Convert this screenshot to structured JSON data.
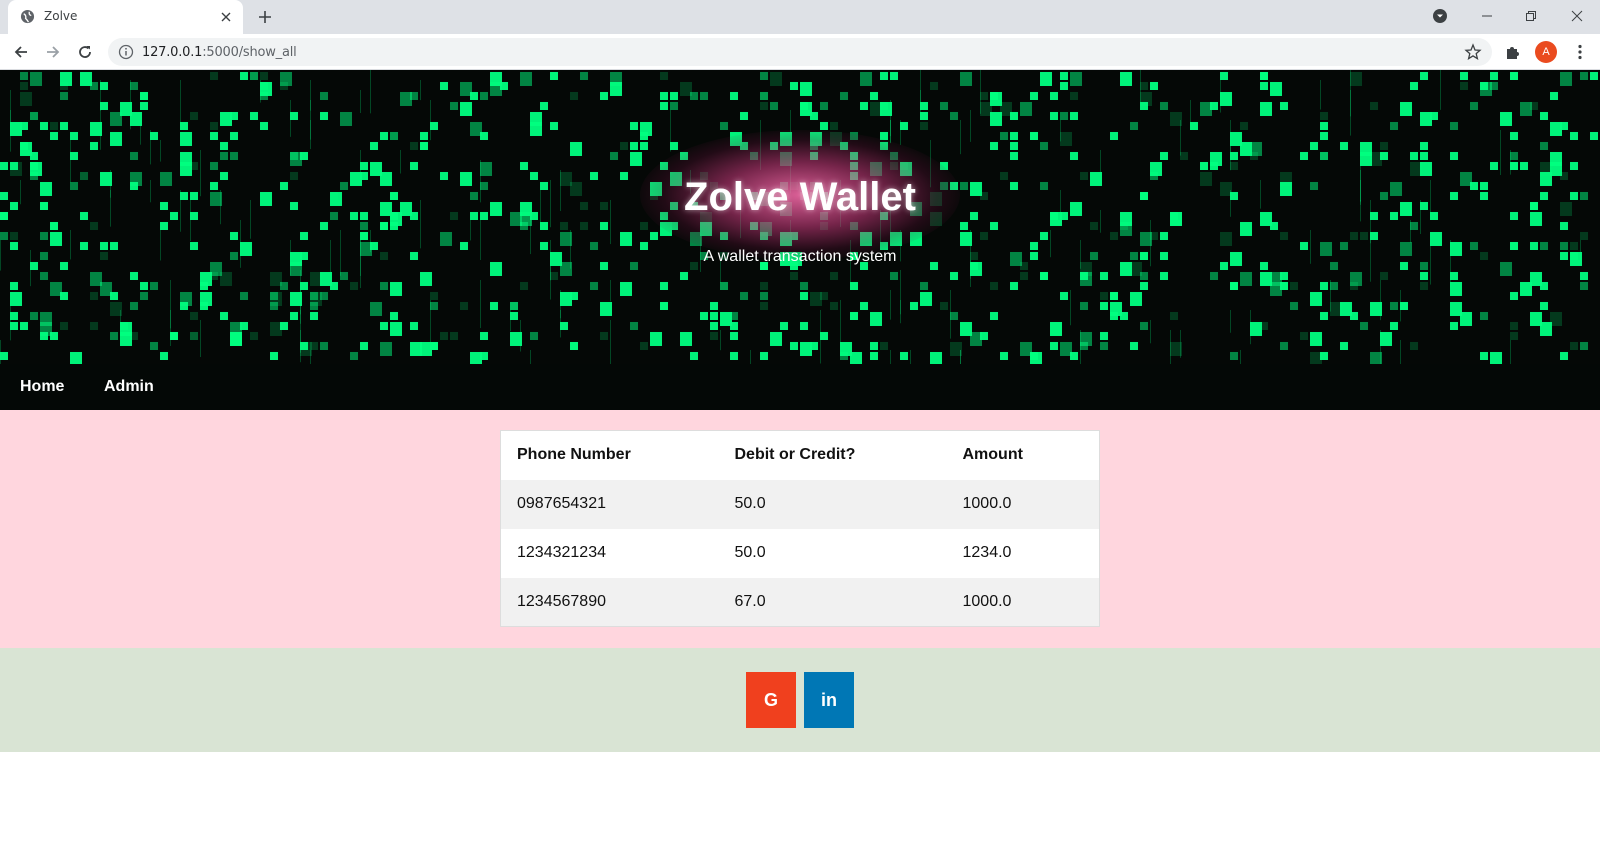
{
  "browser": {
    "tab_title": "Zolve",
    "url_host": "127.0.0.1",
    "url_path": ":5000/show_all",
    "profile_initial": "A"
  },
  "hero": {
    "title": "Zolve Wallet",
    "subtitle": "A wallet transaction system"
  },
  "nav": {
    "home": "Home",
    "admin": "Admin"
  },
  "table": {
    "headers": [
      "Phone Number",
      "Debit or Credit?",
      "Amount"
    ],
    "rows": [
      [
        "0987654321",
        "50.0",
        "1000.0"
      ],
      [
        "1234321234",
        "50.0",
        "1234.0"
      ],
      [
        "1234567890",
        "67.0",
        "1000.0"
      ]
    ]
  },
  "footer": {
    "google_label": "G",
    "linkedin_label": "in"
  },
  "colors": {
    "content_bg": "#ffd6de",
    "footer_bg": "#d9e4d4",
    "google": "#f0401e",
    "linkedin": "#0077b5",
    "matrix_green": "#00ff7f"
  }
}
